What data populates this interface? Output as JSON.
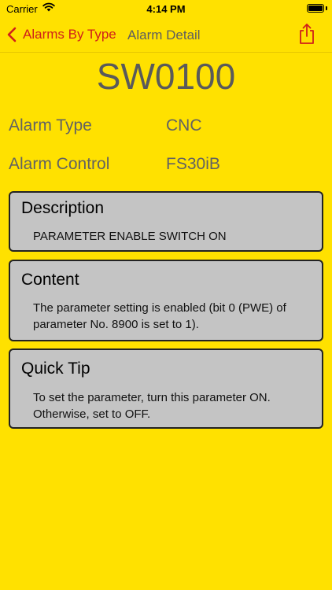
{
  "status_bar": {
    "carrier": "Carrier",
    "time": "4:14 PM",
    "battery_level": 1.0
  },
  "nav": {
    "back_label": "Alarms By Type",
    "title": "Alarm Detail",
    "back_icon": "chevron-left-icon",
    "share_icon": "share-icon"
  },
  "alarm": {
    "code": "SW0100",
    "type_label": "Alarm Type",
    "type_value": "CNC",
    "control_label": "Alarm Control",
    "control_value": "FS30iB"
  },
  "cards": {
    "description": {
      "title": "Description",
      "text": "PARAMETER ENABLE SWITCH ON"
    },
    "content": {
      "title": "Content",
      "text": "The parameter setting is enabled (bit 0 (PWE) of parameter No. 8900 is set to 1)."
    },
    "quick_tip": {
      "title": "Quick Tip",
      "text": "To set the parameter, turn this parameter ON. Otherwise, set to OFF."
    }
  },
  "colors": {
    "background": "#FFE100",
    "accent": "#D0201A",
    "card": "#C4C4C4",
    "muted_text": "#5E5E5E"
  }
}
